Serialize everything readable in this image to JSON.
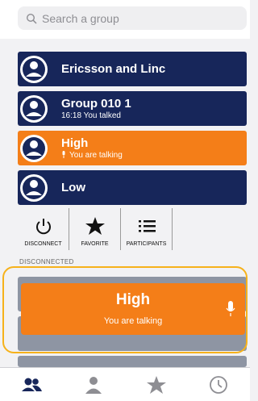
{
  "search": {
    "placeholder": "Search a group"
  },
  "groups": [
    {
      "name": "Ericsson and Linc",
      "sub": ""
    },
    {
      "name": "Group 010 1",
      "sub": "16:18 You talked"
    },
    {
      "name": "High",
      "sub": "You are talking",
      "active": true
    },
    {
      "name": "Low",
      "sub": ""
    }
  ],
  "controls": [
    {
      "label": "DISCONNECT",
      "icon": "power-icon"
    },
    {
      "label": "FAVORITE",
      "icon": "star-icon"
    },
    {
      "label": "PARTICIPANTS",
      "icon": "list-icon"
    }
  ],
  "section": {
    "disconnected_label": "DISCONNECTED"
  },
  "ptt": {
    "group": "High",
    "status": "You are talking"
  },
  "tabs": [
    {
      "name": "groups",
      "icon": "groups-icon"
    },
    {
      "name": "contacts",
      "icon": "person-icon"
    },
    {
      "name": "favorites",
      "icon": "star-icon"
    },
    {
      "name": "history",
      "icon": "clock-icon"
    }
  ],
  "colors": {
    "navy": "#17265a",
    "orange": "#f47e18",
    "frame": "#f6b21b"
  }
}
